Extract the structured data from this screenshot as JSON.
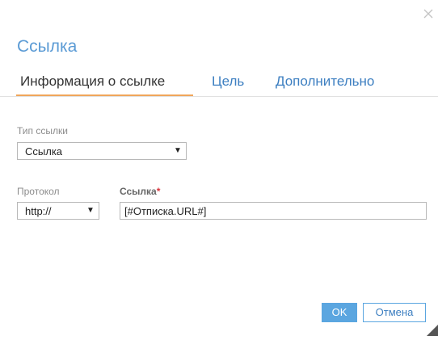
{
  "dialog": {
    "title": "Ссылка",
    "close_icon": "close-icon"
  },
  "tabs": [
    {
      "label": "Информация о ссылке",
      "active": true
    },
    {
      "label": "Цель",
      "active": false
    },
    {
      "label": "Дополнительно",
      "active": false
    }
  ],
  "link_type": {
    "label": "Тип ссылки",
    "selected": "Ссылка"
  },
  "protocol": {
    "label": "Протокол",
    "selected": "http://"
  },
  "url": {
    "label": "Ссылка",
    "required_mark": "*",
    "value": "[#Отписка.URL#]"
  },
  "buttons": {
    "ok": "OK",
    "cancel": "Отмена"
  },
  "colors": {
    "accent": "#5ba6e0",
    "tab_underline": "#f0a55a",
    "link": "#3d7fc1",
    "required": "#d9363e"
  }
}
